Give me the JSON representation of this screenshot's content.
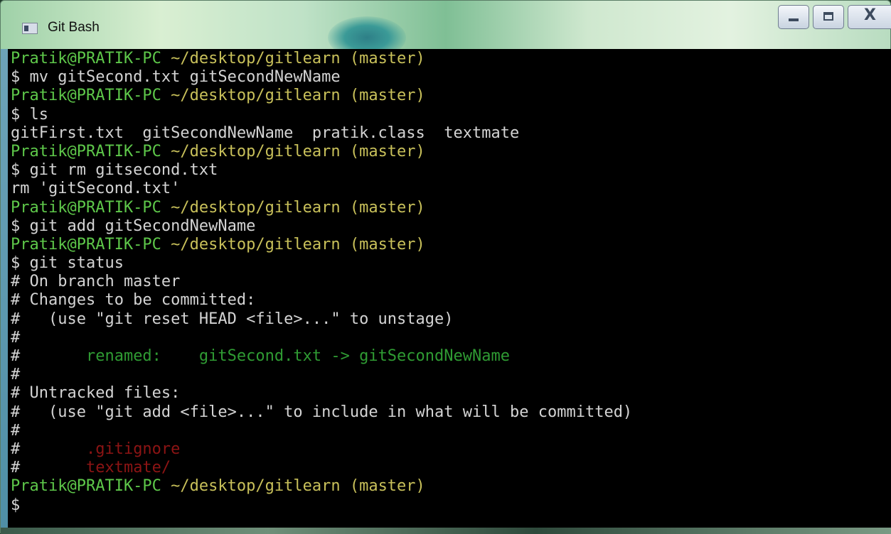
{
  "window": {
    "title": "Git Bash",
    "controls": {
      "minimize": "minimize",
      "maximize": "maximize",
      "close": "X"
    }
  },
  "colors": {
    "prompt_user": "#5ec84a",
    "prompt_path": "#c8c05a",
    "output": "#d4d4d4",
    "staged": "#2f9b33",
    "untracked": "#8c1414",
    "background": "#000000"
  },
  "terminal": {
    "lines": [
      {
        "type": "prompt",
        "user": "Pratik@PRATIK-PC",
        "path": "~/desktop/gitlearn (master)"
      },
      {
        "type": "command",
        "text": "$ mv gitSecond.txt gitSecondNewName"
      },
      {
        "type": "prompt",
        "user": "Pratik@PRATIK-PC",
        "path": "~/desktop/gitlearn (master)"
      },
      {
        "type": "command",
        "text": "$ ls"
      },
      {
        "type": "output",
        "text": "gitFirst.txt  gitSecondNewName  pratik.class  textmate"
      },
      {
        "type": "prompt",
        "user": "Pratik@PRATIK-PC",
        "path": "~/desktop/gitlearn (master)"
      },
      {
        "type": "command",
        "text": "$ git rm gitsecond.txt"
      },
      {
        "type": "output",
        "text": "rm 'gitSecond.txt'"
      },
      {
        "type": "prompt",
        "user": "Pratik@PRATIK-PC",
        "path": "~/desktop/gitlearn (master)"
      },
      {
        "type": "command",
        "text": "$ git add gitSecondNewName"
      },
      {
        "type": "prompt",
        "user": "Pratik@PRATIK-PC",
        "path": "~/desktop/gitlearn (master)"
      },
      {
        "type": "command",
        "text": "$ git status"
      },
      {
        "type": "output",
        "text": "# On branch master"
      },
      {
        "type": "output",
        "text": "# Changes to be committed:"
      },
      {
        "type": "output",
        "text": "#   (use \"git reset HEAD <file>...\" to unstage)"
      },
      {
        "type": "output",
        "text": "#"
      },
      {
        "type": "staged",
        "hash": "#",
        "text": "       renamed:    gitSecond.txt -> gitSecondNewName"
      },
      {
        "type": "output",
        "text": "#"
      },
      {
        "type": "output",
        "text": "# Untracked files:"
      },
      {
        "type": "output",
        "text": "#   (use \"git add <file>...\" to include in what will be committed)"
      },
      {
        "type": "output",
        "text": "#"
      },
      {
        "type": "untracked",
        "hash": "#",
        "text": "       .gitignore"
      },
      {
        "type": "untracked",
        "hash": "#",
        "text": "       textmate/"
      },
      {
        "type": "prompt",
        "user": "Pratik@PRATIK-PC",
        "path": "~/desktop/gitlearn (master)"
      },
      {
        "type": "command",
        "text": "$"
      }
    ]
  }
}
